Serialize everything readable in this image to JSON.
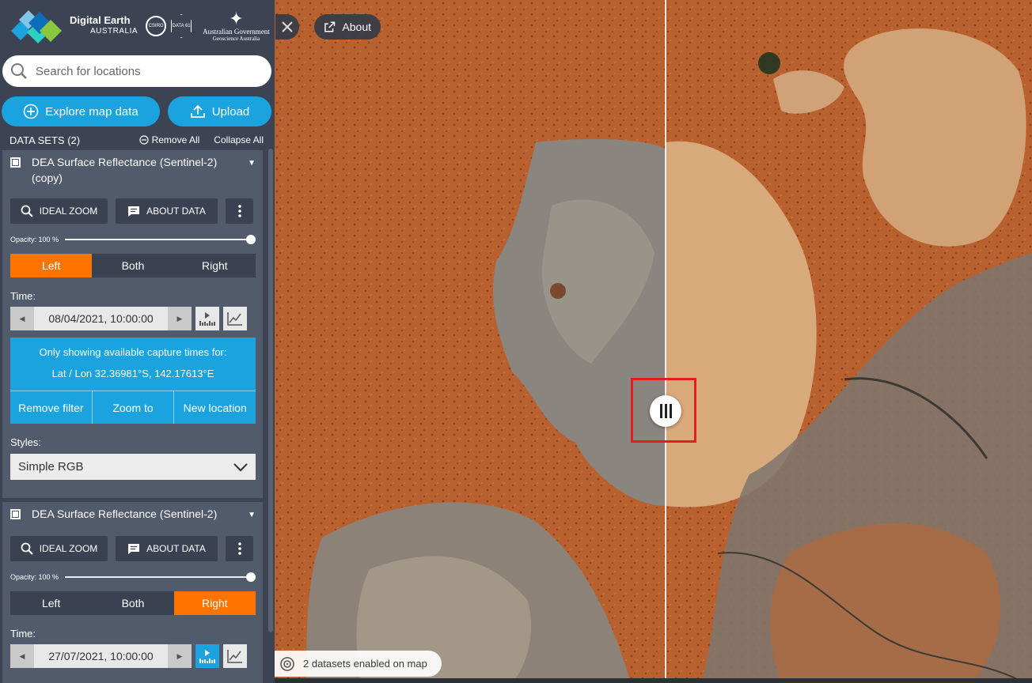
{
  "brand": {
    "name": "Digital Earth",
    "sub": "AUSTRALIA",
    "csiro": "CSIRO",
    "data61": "DATA 61",
    "gov_line1": "Australian Government",
    "gov_line2": "Geoscience Australia"
  },
  "search": {
    "placeholder": "Search for locations"
  },
  "actions": {
    "explore_label": "Explore map data",
    "upload_label": "Upload"
  },
  "datasets": {
    "title": "DATA SETS (2)",
    "remove_all": "Remove All",
    "collapse_all": "Collapse All"
  },
  "items": [
    {
      "name": "DEA Surface Reflectance (Sentinel-2) (copy)",
      "ideal_zoom": "IDEAL ZOOM",
      "about_data": "ABOUT DATA",
      "opacity_label": "Opacity: 100 %",
      "opacity": 1.0,
      "split": [
        "Left",
        "Both",
        "Right"
      ],
      "split_active": "Left",
      "time_label": "Time:",
      "time_value": "08/04/2021, 10:00:00",
      "filter_msg_1": "Only showing available capture times for:",
      "filter_msg_2": "Lat / Lon 32.36981°S, 142.17613°E",
      "filter_actions": [
        "Remove filter",
        "Zoom to",
        "New location"
      ],
      "styles_label": "Styles:",
      "style_value": "Simple RGB"
    },
    {
      "name": "DEA Surface Reflectance (Sentinel-2)",
      "ideal_zoom": "IDEAL ZOOM",
      "about_data": "ABOUT DATA",
      "opacity_label": "Opacity: 100 %",
      "opacity": 1.0,
      "split": [
        "Left",
        "Both",
        "Right"
      ],
      "split_active": "Right",
      "time_label": "Time:",
      "time_value": "27/07/2021, 10:00:00"
    }
  ],
  "map": {
    "about_label": "About",
    "datasets_enabled": "2 datasets enabled on map"
  },
  "colors": {
    "accent_blue": "#1ba3e0",
    "active_orange": "#ff7300",
    "panel": "#3c4454",
    "item_bg": "#525b6b",
    "highlight": "#e21d1d"
  },
  "icons": [
    "brand-logo-icon",
    "search-icon",
    "plus-circle-icon",
    "upload-icon",
    "minus-circle-icon",
    "chevron-down-icon",
    "magnifier-icon",
    "comment-icon",
    "kebab-icon",
    "play-left-icon",
    "play-right-icon",
    "bar-chart-icon",
    "line-chart-icon",
    "close-icon",
    "external-link-icon",
    "split-handle-icon",
    "layers-icon"
  ]
}
